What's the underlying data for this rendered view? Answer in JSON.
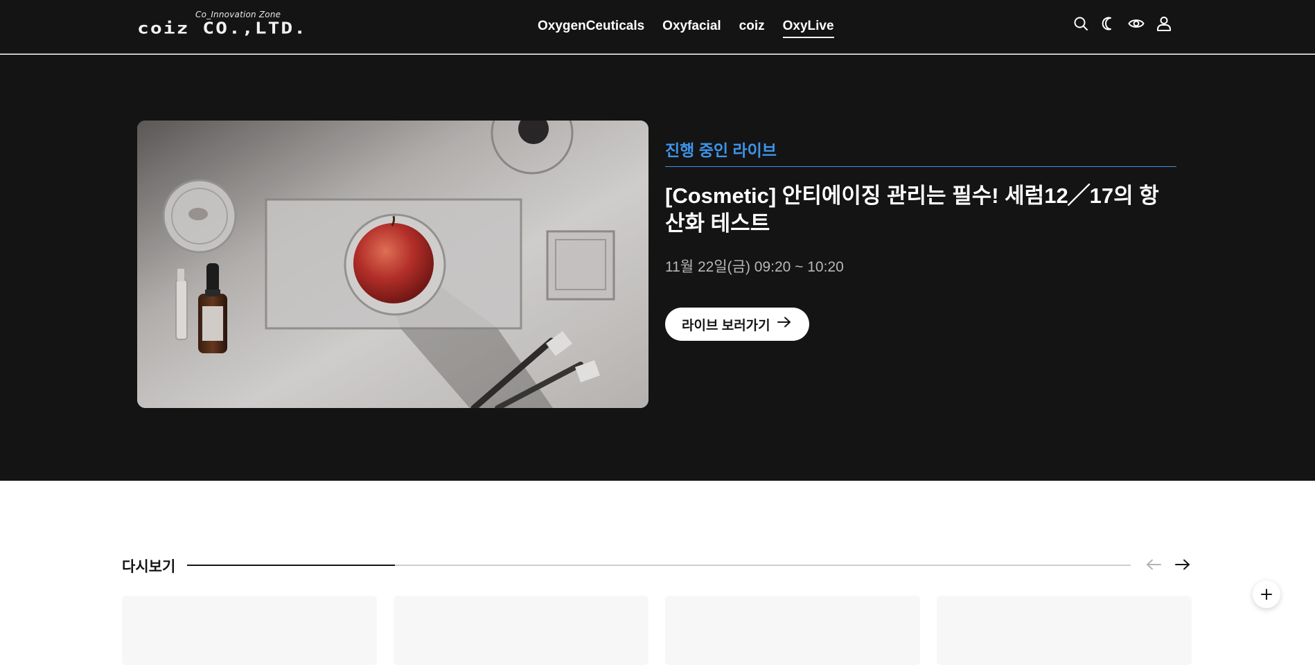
{
  "header": {
    "logo_tagline": "Co_Innovation Zone",
    "logo_text": "coiz CO.,LTD.",
    "nav": [
      {
        "label": "OxygenCeuticals",
        "active": false
      },
      {
        "label": "Oxyfacial",
        "active": false
      },
      {
        "label": "coiz",
        "active": false
      },
      {
        "label": "OxyLive",
        "active": true
      }
    ],
    "icons": [
      "search-icon",
      "moon-icon",
      "eye-icon",
      "user-icon"
    ]
  },
  "hero": {
    "section_label": "진행 중인 라이브",
    "title": "[Cosmetic] 안티에이징 관리는 필수! 세럼12╱17의 항산화 테스트",
    "schedule": "11월 22일(금) 09:20 ~ 10:20",
    "button_label": "라이브 보러가기",
    "button_icon": "arrow-right-icon"
  },
  "replay": {
    "title": "다시보기",
    "progress": 0.22,
    "prev_icon": "arrow-left-icon",
    "next_icon": "arrow-right-icon"
  },
  "fab_icon": "plus-icon",
  "colors": {
    "dark_bg": "#141414",
    "accent_blue": "#3d94ea",
    "card_bg": "#f7f7f7"
  }
}
